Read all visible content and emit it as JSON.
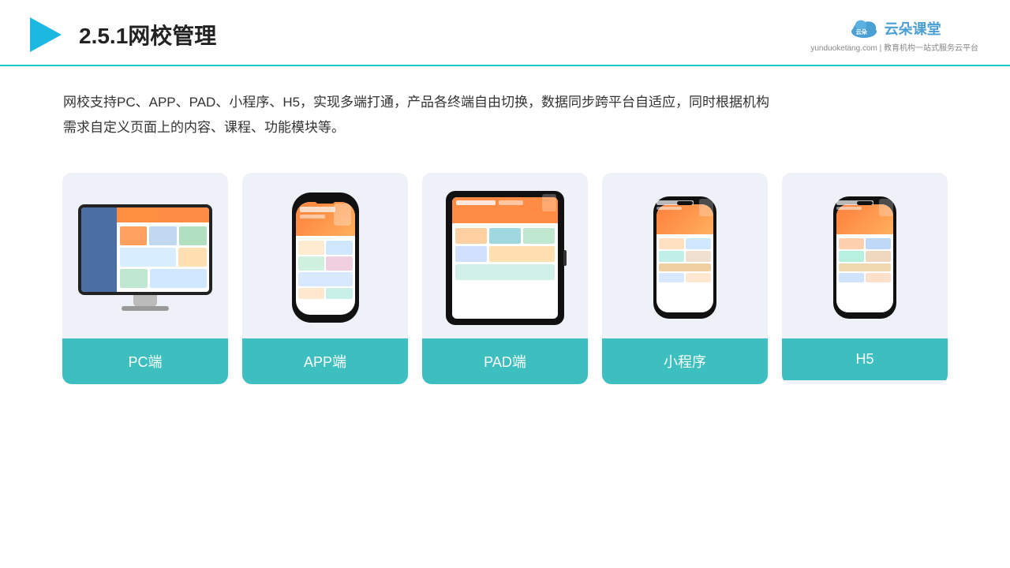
{
  "header": {
    "title": "2.5.1网校管理",
    "logo_brand": "云朵课堂",
    "logo_domain": "yunduoketang.com",
    "logo_tagline": "教育机构一站\n式服务云平台"
  },
  "description": {
    "text1": "网校支持PC、APP、PAD、小程序、H5，实现多端打通，产品各终端自由切换，数据同步跨平台自适应，同时根据机构",
    "text2": "需求自定义页面上的内容、课程、功能模块等。"
  },
  "cards": [
    {
      "id": "pc",
      "label": "PC端",
      "type": "monitor"
    },
    {
      "id": "app",
      "label": "APP端",
      "type": "phone"
    },
    {
      "id": "pad",
      "label": "PAD端",
      "type": "tablet"
    },
    {
      "id": "miniprogram",
      "label": "小程序",
      "type": "small-phone"
    },
    {
      "id": "h5",
      "label": "H5",
      "type": "small-phone"
    }
  ],
  "colors": {
    "accent": "#3cbfbe",
    "header_border": "#1cc8c8",
    "card_bg": "#eef2f8",
    "card_label_bg": "#3cbfbe"
  }
}
